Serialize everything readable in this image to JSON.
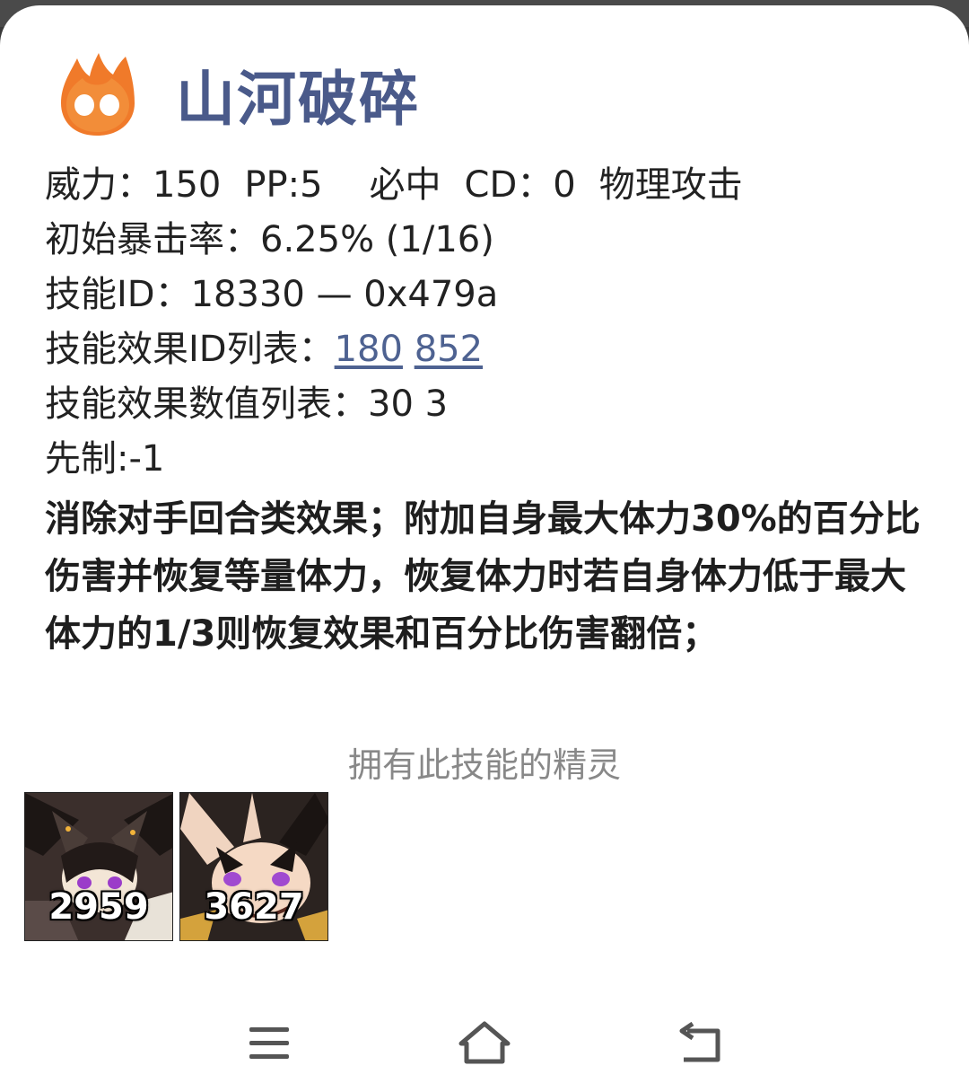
{
  "skill": {
    "title": "山河破碎",
    "icon": "fire-type-icon",
    "power_label": "威力：",
    "power": "150",
    "pp_label": "PP:",
    "pp": "5",
    "accuracy": "必中",
    "cd_label": "CD：",
    "cd": "0",
    "category": "物理攻击",
    "crit_label": "初始暴击率：",
    "crit": "6.25% (1/16)",
    "id_label": "技能ID：",
    "id": "18330 — 0x479a",
    "effect_ids_label": "技能效果ID列表：",
    "effect_ids": [
      "180",
      "852"
    ],
    "effect_values_label": "技能效果数值列表：",
    "effect_values": "30 3",
    "priority_label": "先制:",
    "priority": "-1",
    "description": "消除对手回合类效果；附加自身最大体力30%的百分比伤害并恢复等量体力，恢复体力时若自身体力低于最大体力的1/3则恢复效果和百分比伤害翻倍；"
  },
  "owners": {
    "title": "拥有此技能的精灵",
    "sprites": [
      {
        "id": "2959"
      },
      {
        "id": "3627"
      }
    ]
  },
  "navbar": {
    "items": [
      "menu-icon",
      "home-icon",
      "back-icon"
    ]
  },
  "colors": {
    "title": "#4a5a8a",
    "link": "#4e6291",
    "fire": "#f07a2a"
  }
}
